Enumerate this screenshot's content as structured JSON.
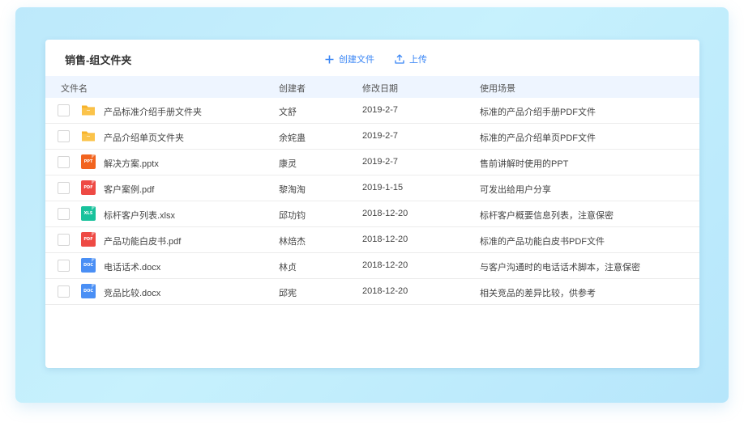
{
  "header": {
    "title": "销售-组文件夹",
    "create_label": "创建文件",
    "upload_label": "上传"
  },
  "columns": [
    "文件名",
    "创建者",
    "修改日期",
    "使用场景"
  ],
  "files": [
    {
      "name": "产品标准介绍手册文件夹",
      "creator": "文舒",
      "date": "2019-2-7",
      "use": "标准的产品介绍手册PDF文件",
      "icon": "folder-icon",
      "tag": "",
      "color": "#f7b32b"
    },
    {
      "name": "产品介绍单页文件夹",
      "creator": "余姹蛊",
      "date": "2019-2-7",
      "use": "标准的产品介绍单页PDF文件",
      "icon": "folder-icon",
      "tag": "",
      "color": "#f7b32b"
    },
    {
      "name": "解决方案.pptx",
      "creator": "康灵",
      "date": "2019-2-7",
      "use": "售前讲解时使用的PPT",
      "icon": "ppt-file-icon",
      "tag": "PPT",
      "color": "#f2641f"
    },
    {
      "name": "客户案例.pdf",
      "creator": "黎淘淘",
      "date": "2019-1-15",
      "use": "可发出给用户分享",
      "icon": "pdf-file-icon",
      "tag": "PDF",
      "color": "#ee4a44"
    },
    {
      "name": "标杆客户列表.xlsx",
      "creator": "邱功钧",
      "date": "2018-12-20",
      "use": "标杆客户概要信息列表，注意保密",
      "icon": "xls-file-icon",
      "tag": "XLS",
      "color": "#18c29c"
    },
    {
      "name": "产品功能白皮书.pdf",
      "creator": "林焙杰",
      "date": "2018-12-20",
      "use": "标准的产品功能白皮书PDF文件",
      "icon": "pdf-file-icon",
      "tag": "PDF",
      "color": "#ee4a44"
    },
    {
      "name": "电话话术.docx",
      "creator": "林贞",
      "date": "2018-12-20",
      "use": "与客户沟通时的电话话术脚本，注意保密",
      "icon": "doc-file-icon",
      "tag": "DOC",
      "color": "#4a8ff5"
    },
    {
      "name": "竞品比较.docx",
      "creator": "邱宪",
      "date": "2018-12-20",
      "use": "相关竞品的差异比较，供参考",
      "icon": "doc-file-icon",
      "tag": "DOC",
      "color": "#4a8ff5"
    }
  ]
}
